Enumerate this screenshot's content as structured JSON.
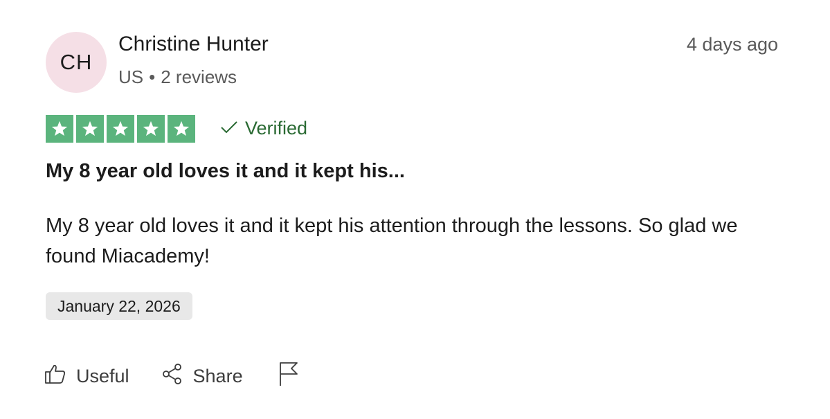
{
  "reviewer": {
    "initials": "CH",
    "name": "Christine Hunter",
    "country": "US",
    "separator": "•",
    "reviews": "2 reviews"
  },
  "posted_ago": "4 days ago",
  "rating": {
    "value": 5,
    "max": 5
  },
  "verified_label": "Verified",
  "review": {
    "title": "My 8 year old loves it and it kept his...",
    "body": "My 8 year old loves it and it kept his attention through the lessons. So glad we found Miacademy!"
  },
  "experience_date": "January 22, 2026",
  "actions": {
    "useful_label": "Useful",
    "share_label": "Share"
  },
  "colors": {
    "star_fill": "#5bb47d",
    "verified": "#2a6a33",
    "avatar_bg": "#f5dfe6",
    "chip_bg": "#e8e8e8"
  },
  "icons": [
    "thumbs-up-icon",
    "share-icon",
    "flag-icon",
    "checkmark-icon",
    "star-icon"
  ]
}
